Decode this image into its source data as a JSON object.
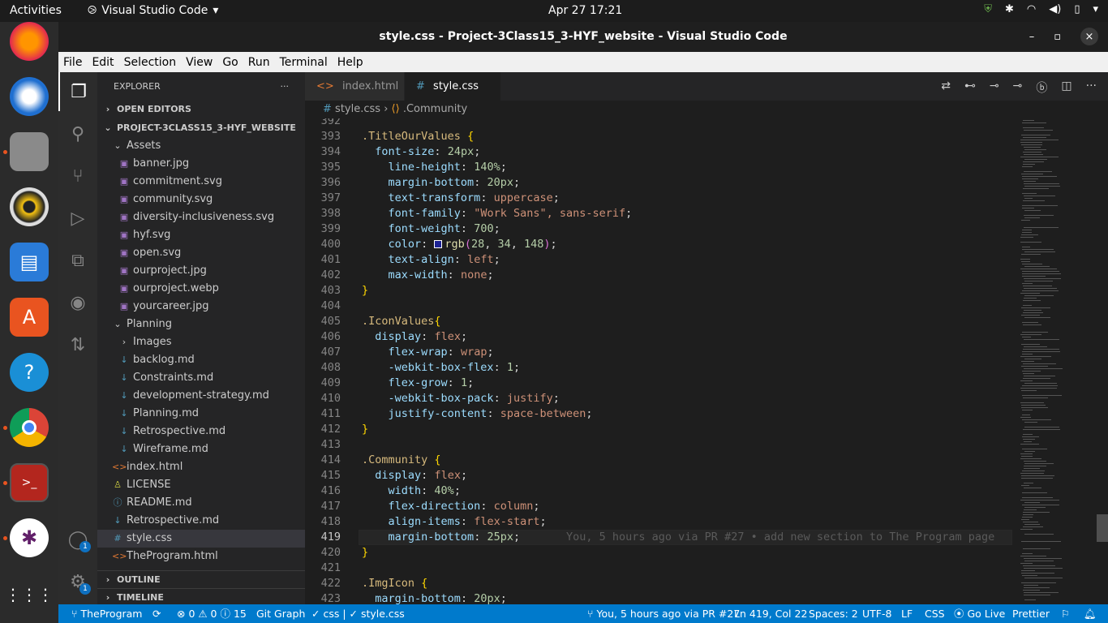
{
  "topbar": {
    "activities": "Activities",
    "app_name": "Visual Studio Code",
    "clock": "Apr 27  17:21"
  },
  "window": {
    "title": "style.css - Project-3Class15_3-HYF_website - Visual Studio Code"
  },
  "menu": [
    "File",
    "Edit",
    "Selection",
    "View",
    "Go",
    "Run",
    "Terminal",
    "Help"
  ],
  "activity_badges": {
    "accounts": "1",
    "manage": "1"
  },
  "explorer": {
    "title": "EXPLORER",
    "more": "···",
    "open_editors": "OPEN EDITORS",
    "project": "PROJECT-3CLASS15_3-HYF_WEBSITE",
    "tree": [
      {
        "label": "Assets",
        "type": "folder-open",
        "indent": 1
      },
      {
        "label": "banner.jpg",
        "type": "img",
        "indent": 2
      },
      {
        "label": "commitment.svg",
        "type": "img",
        "indent": 2
      },
      {
        "label": "community.svg",
        "type": "img",
        "indent": 2
      },
      {
        "label": "diversity-inclusiveness.svg",
        "type": "img",
        "indent": 2
      },
      {
        "label": "hyf.svg",
        "type": "img",
        "indent": 2
      },
      {
        "label": "open.svg",
        "type": "img",
        "indent": 2
      },
      {
        "label": "ourproject.jpg",
        "type": "img",
        "indent": 2
      },
      {
        "label": "ourproject.webp",
        "type": "img",
        "indent": 2
      },
      {
        "label": "yourcareer.jpg",
        "type": "img",
        "indent": 2
      },
      {
        "label": "Planning",
        "type": "folder-open",
        "indent": 1
      },
      {
        "label": "Images",
        "type": "folder-closed",
        "indent": 2
      },
      {
        "label": "backlog.md",
        "type": "md",
        "indent": 2
      },
      {
        "label": "Constraints.md",
        "type": "md",
        "indent": 2
      },
      {
        "label": "development-strategy.md",
        "type": "md",
        "indent": 2
      },
      {
        "label": "Planning.md",
        "type": "md",
        "indent": 2
      },
      {
        "label": "Retrospective.md",
        "type": "md",
        "indent": 2
      },
      {
        "label": "Wireframe.md",
        "type": "md",
        "indent": 2
      },
      {
        "label": "index.html",
        "type": "html",
        "indent": 1
      },
      {
        "label": "LICENSE",
        "type": "lic",
        "indent": 1
      },
      {
        "label": "README.md",
        "type": "info",
        "indent": 1
      },
      {
        "label": "Retrospective.md",
        "type": "md",
        "indent": 1
      },
      {
        "label": "style.css",
        "type": "css",
        "indent": 1,
        "selected": true
      },
      {
        "label": "TheProgram.html",
        "type": "html",
        "indent": 1
      }
    ],
    "outline": "OUTLINE",
    "timeline": "TIMELINE"
  },
  "tabs": [
    {
      "label": "index.html",
      "icon": "<>",
      "active": false
    },
    {
      "label": "style.css",
      "icon": "#",
      "active": true,
      "close": "×"
    }
  ],
  "breadcrumb": {
    "file": "style.css",
    "symbol": ".Community"
  },
  "code": {
    "current_line": 419,
    "blame": "You, 5 hours ago via PR #27 • add new section to The Program page",
    "lines": [
      {
        "n": 392,
        "t": ""
      },
      {
        "n": 393,
        "t": ".TitleOurValues {"
      },
      {
        "n": 394,
        "t": "  font-size: 24px;"
      },
      {
        "n": 395,
        "t": "    line-height: 140%;"
      },
      {
        "n": 396,
        "t": "    margin-bottom: 20px;"
      },
      {
        "n": 397,
        "t": "    text-transform: uppercase;"
      },
      {
        "n": 398,
        "t": "    font-family: \"Work Sans\", sans-serif;"
      },
      {
        "n": 399,
        "t": "    font-weight: 700;"
      },
      {
        "n": 400,
        "t": "    color: ▢rgb(28, 34, 148);"
      },
      {
        "n": 401,
        "t": "    text-align: left;"
      },
      {
        "n": 402,
        "t": "    max-width: none;"
      },
      {
        "n": 403,
        "t": "}"
      },
      {
        "n": 404,
        "t": ""
      },
      {
        "n": 405,
        "t": ".IconValues{"
      },
      {
        "n": 406,
        "t": "  display: flex;"
      },
      {
        "n": 407,
        "t": "    flex-wrap: wrap;"
      },
      {
        "n": 408,
        "t": "    -webkit-box-flex: 1;"
      },
      {
        "n": 409,
        "t": "    flex-grow: 1;"
      },
      {
        "n": 410,
        "t": "    -webkit-box-pack: justify;"
      },
      {
        "n": 411,
        "t": "    justify-content: space-between;"
      },
      {
        "n": 412,
        "t": "}"
      },
      {
        "n": 413,
        "t": ""
      },
      {
        "n": 414,
        "t": ".Community {"
      },
      {
        "n": 415,
        "t": "  display: flex;"
      },
      {
        "n": 416,
        "t": "    width: 40%;"
      },
      {
        "n": 417,
        "t": "    flex-direction: column;"
      },
      {
        "n": 418,
        "t": "    align-items: flex-start;"
      },
      {
        "n": 419,
        "t": "    margin-bottom: 25px;"
      },
      {
        "n": 420,
        "t": "}"
      },
      {
        "n": 421,
        "t": ""
      },
      {
        "n": 422,
        "t": ".ImgIcon {"
      },
      {
        "n": 423,
        "t": "  margin-bottom: 20px;"
      }
    ]
  },
  "status": {
    "branch": "TheProgram",
    "problems": "⊗ 0 ⚠ 0 ⓘ 15",
    "git_graph": "Git Graph",
    "css_check": "✓ css | ✓ style.css",
    "blame": "You, 5 hours ago via PR #27",
    "position": "Ln 419, Col 22",
    "spaces": "Spaces: 2",
    "encoding": "UTF-8",
    "eol": "LF",
    "language": "CSS",
    "go_live": "Go Live",
    "prettier": "Prettier"
  },
  "colors": {
    "status_bar": "#007acc",
    "editor_bg": "#1e1e1e",
    "swatch": "#1c2294"
  }
}
